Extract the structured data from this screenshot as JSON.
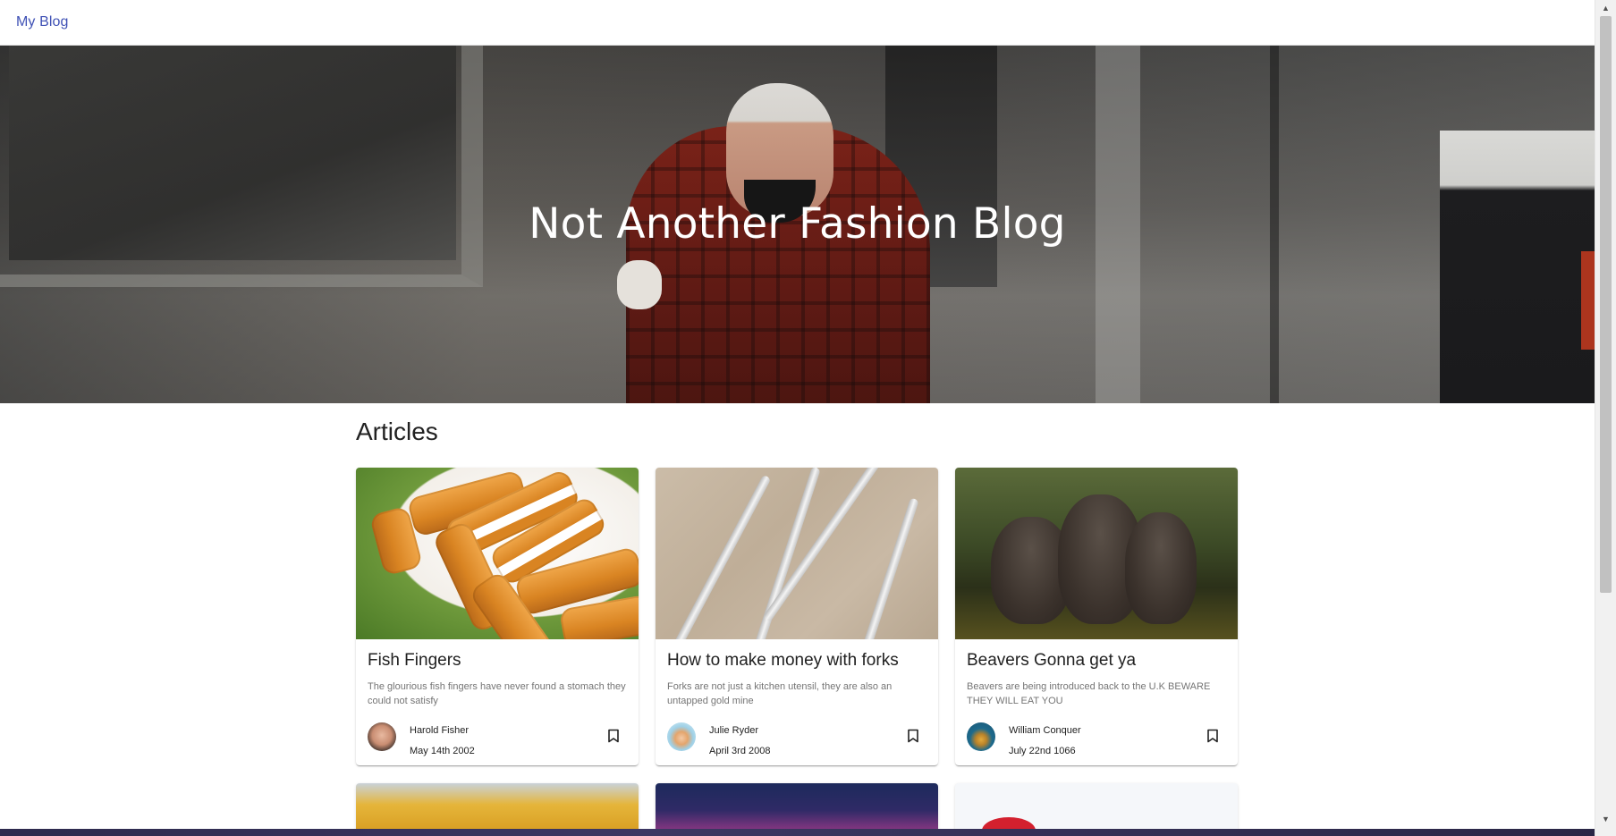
{
  "appbar": {
    "brand": "My Blog"
  },
  "hero": {
    "title": "Not Another Fashion Blog"
  },
  "articles": {
    "heading": "Articles",
    "cards": [
      {
        "title": "Fish Fingers",
        "excerpt": "The glourious fish fingers have never found a stomach they could not satisfy",
        "author": "Harold Fisher",
        "date": "May 14th 2002"
      },
      {
        "title": "How to make money with forks",
        "excerpt": "Forks are not just a kitchen utensil, they are also an untapped gold mine",
        "author": "Julie Ryder",
        "date": "April 3rd 2008"
      },
      {
        "title": "Beavers Gonna get ya",
        "excerpt": "Beavers are being introduced back to the U.K BEWARE THEY WILL EAT YOU",
        "author": "William Conquer",
        "date": "July 22nd 1066"
      }
    ]
  },
  "icons": {
    "bookmark": "bookmark-border-icon",
    "scroll_up": "scroll-up-arrow-icon",
    "scroll_down": "scroll-down-arrow-icon"
  },
  "colors": {
    "brand": "#3f51b5",
    "text_primary": "#212121",
    "text_secondary": "#757575"
  }
}
